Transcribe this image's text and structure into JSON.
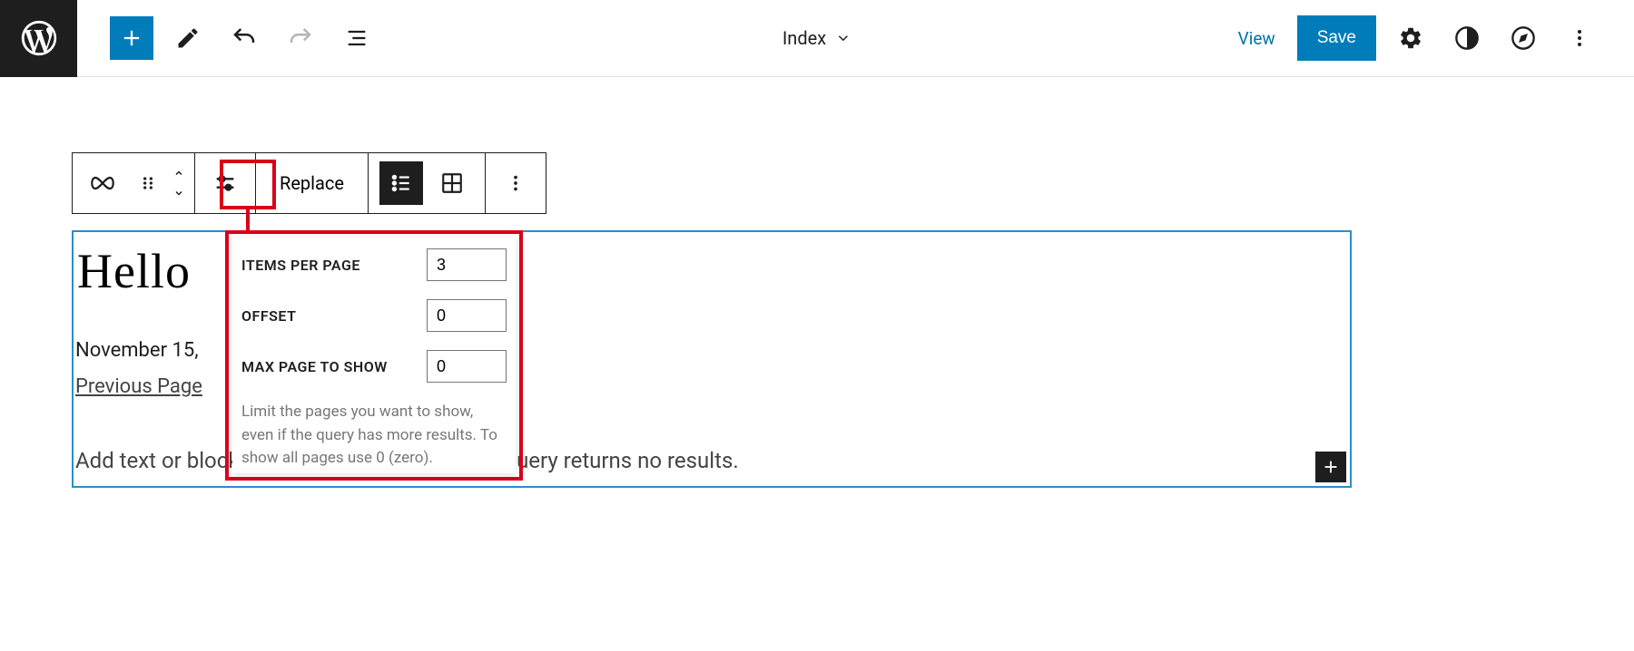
{
  "header": {
    "document_title": "Index",
    "view_label": "View",
    "save_label": "Save"
  },
  "block_toolbar": {
    "replace_label": "Replace"
  },
  "editor": {
    "title": "Hello",
    "date": "November 15,",
    "prev_page": "Previous Page",
    "no_results_placeholder": "Add text or blocks that will display when the query returns no results."
  },
  "popover": {
    "items_per_page": {
      "label": "ITEMS PER PAGE",
      "value": "3"
    },
    "offset": {
      "label": "OFFSET",
      "value": "0"
    },
    "max_page": {
      "label": "MAX PAGE TO SHOW",
      "value": "0"
    },
    "help_text": "Limit the pages you want to show, even if the query has more results. To show all pages use 0 (zero)."
  },
  "colors": {
    "accent": "#007cba",
    "highlight": "#d9001b",
    "selection": "#288ecb"
  }
}
